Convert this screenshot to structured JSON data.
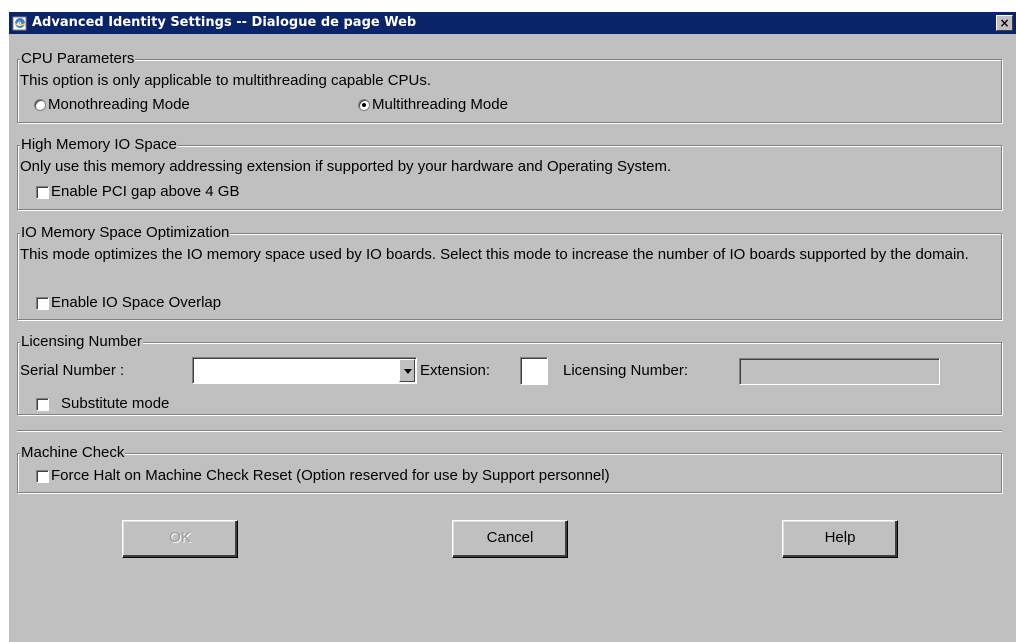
{
  "window": {
    "title": "Advanced Identity Settings -- Dialogue de page Web",
    "close_label": "×"
  },
  "cpu": {
    "legend": "CPU Parameters",
    "description": "This option is only applicable to multithreading capable CPUs.",
    "mono_label": "Monothreading Mode",
    "multi_label": "Multithreading Mode",
    "selected": "multi"
  },
  "high_memory": {
    "legend": "High Memory IO Space",
    "description": "Only use this memory addressing extension if supported by your hardware and Operating System.",
    "checkbox_label": "Enable PCI gap above 4 GB",
    "checked": false
  },
  "io_memory": {
    "legend": "IO Memory Space Optimization",
    "description": "This mode optimizes the IO memory space used by IO boards. Select this mode to increase the number of IO boards supported by the domain.",
    "checkbox_label": "Enable IO Space Overlap",
    "checked": false
  },
  "licensing": {
    "legend": "Licensing Number",
    "serial_label": "Serial Number :",
    "serial_value": "",
    "extension_label": "Extension:",
    "extension_value": "",
    "licensing_label": "Licensing Number:",
    "licensing_value": "",
    "substitute_label": "Substitute mode",
    "substitute_checked": false
  },
  "machine_check": {
    "legend": "Machine Check",
    "checkbox_label": "Force Halt on Machine Check Reset (Option reserved for use by Support personnel)",
    "checked": false
  },
  "buttons": {
    "ok": "OK",
    "cancel": "Cancel",
    "help": "Help",
    "ok_enabled": false
  }
}
